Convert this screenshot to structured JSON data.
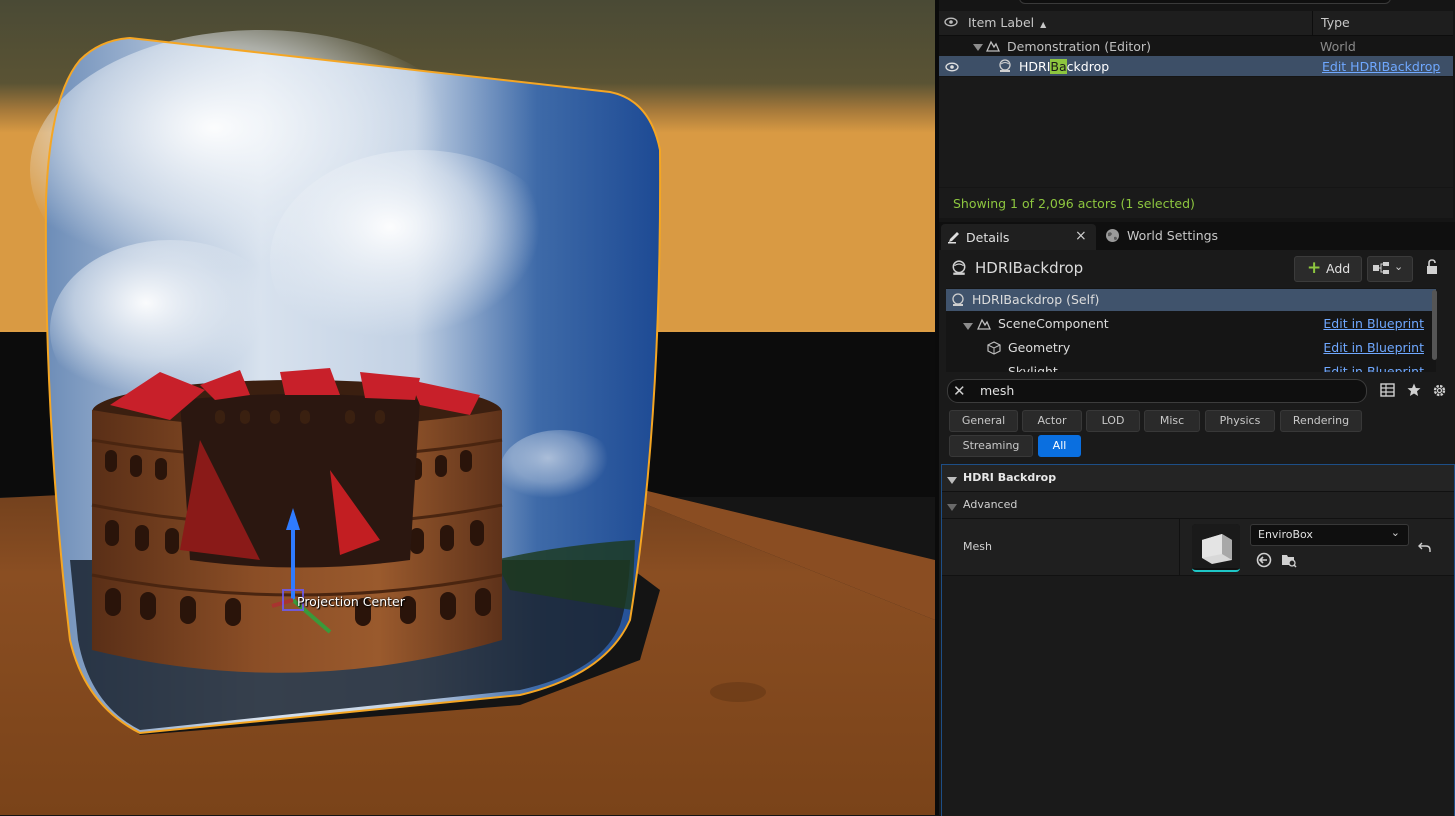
{
  "viewport": {
    "projection_label": "Projection Center"
  },
  "outliner": {
    "col_label": "Item Label",
    "col_type": "Type",
    "rows": [
      {
        "label": "Demonstration (Editor)",
        "type": "World"
      },
      {
        "label_pre": "HDRI",
        "label_hl": "Ba",
        "label_post": "ckdrop",
        "type": "Edit HDRIBackdrop"
      }
    ],
    "status": "Showing 1 of 2,096 actors (1 selected)"
  },
  "tabs": {
    "details": "Details",
    "close": "×",
    "world_settings": "World Settings"
  },
  "details": {
    "actor_name": "HDRIBackdrop",
    "add_label": "Add",
    "components": [
      {
        "label": "HDRIBackdrop (Self)"
      },
      {
        "label": "SceneComponent",
        "link": "Edit in Blueprint"
      },
      {
        "label": "Geometry",
        "link": "Edit in Blueprint"
      },
      {
        "label": "Skylight",
        "link": "Edit in Blueprint"
      }
    ],
    "search_value": "mesh",
    "filters": [
      "General",
      "Actor",
      "LOD",
      "Misc",
      "Physics",
      "Rendering",
      "Streaming",
      "All"
    ],
    "category": "HDRI Backdrop",
    "subcategory": "Advanced",
    "property_label": "Mesh",
    "property_value": "EnviroBox"
  },
  "colors": {
    "selection": "#3d4f67",
    "accent_blue": "#0a6fe0",
    "status_green": "#8dc63f",
    "link": "#6fa8ff",
    "selection_outline": "#f5a623"
  }
}
